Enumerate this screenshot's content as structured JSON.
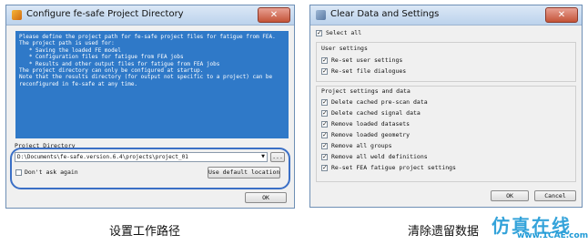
{
  "left_dialog": {
    "title": "Configure fe-safe Project Directory",
    "close_label": "✕",
    "info_lines": [
      "Please define the project path for fe-safe project files for fatigue from FEA.",
      "The project path is used for:",
      "",
      "   * Saving the loaded FE model",
      "   * Configuration files for fatigue from FEA jobs",
      "   * Results and other output files for fatigue from FEA jobs",
      "",
      "The project directory can only be configured at startup.",
      "",
      "Note that the results directory (for output not specific to a project) can be",
      "reconfigured in fe-safe at any time."
    ],
    "project_dir_label": "Project Directory",
    "path_value": "D:\\Documents\\fe-safe.version.6.4\\projects\\project_01",
    "dropdown_arrow": "▼",
    "browse_label": "...",
    "dont_ask_label": "Don't ask again",
    "dont_ask_checked": false,
    "use_default_label": "Use default location",
    "ok_label": "OK",
    "caption": "设置工作路径"
  },
  "right_dialog": {
    "title": "Clear Data and Settings",
    "close_label": "✕",
    "select_all_label": "Select all",
    "user_settings_label": "User settings",
    "user_settings": [
      {
        "label": "Re-set user settings",
        "checked": true
      },
      {
        "label": "Re-set file dialogues",
        "checked": true
      }
    ],
    "project_settings_label": "Project settings and data",
    "project_settings": [
      {
        "label": "Delete cached pre-scan data",
        "checked": true
      },
      {
        "label": "Delete cached signal data",
        "checked": true
      },
      {
        "label": "Remove loaded datasets",
        "checked": true
      },
      {
        "label": "Remove loaded geometry",
        "checked": true
      },
      {
        "label": "Remove all groups",
        "checked": true
      },
      {
        "label": "Remove all weld definitions",
        "checked": true
      },
      {
        "label": "Re-set FEA fatigue project settings",
        "checked": true
      }
    ],
    "ok_label": "OK",
    "cancel_label": "Cancel",
    "caption": "清除遗留数据"
  },
  "watermark": {
    "text": "仿真在线",
    "url": "www.1CAE.com"
  },
  "colors": {
    "info_panel": "#2f79c8",
    "highlight": "#3a6fc6",
    "watermark": "#1f9ad6"
  }
}
